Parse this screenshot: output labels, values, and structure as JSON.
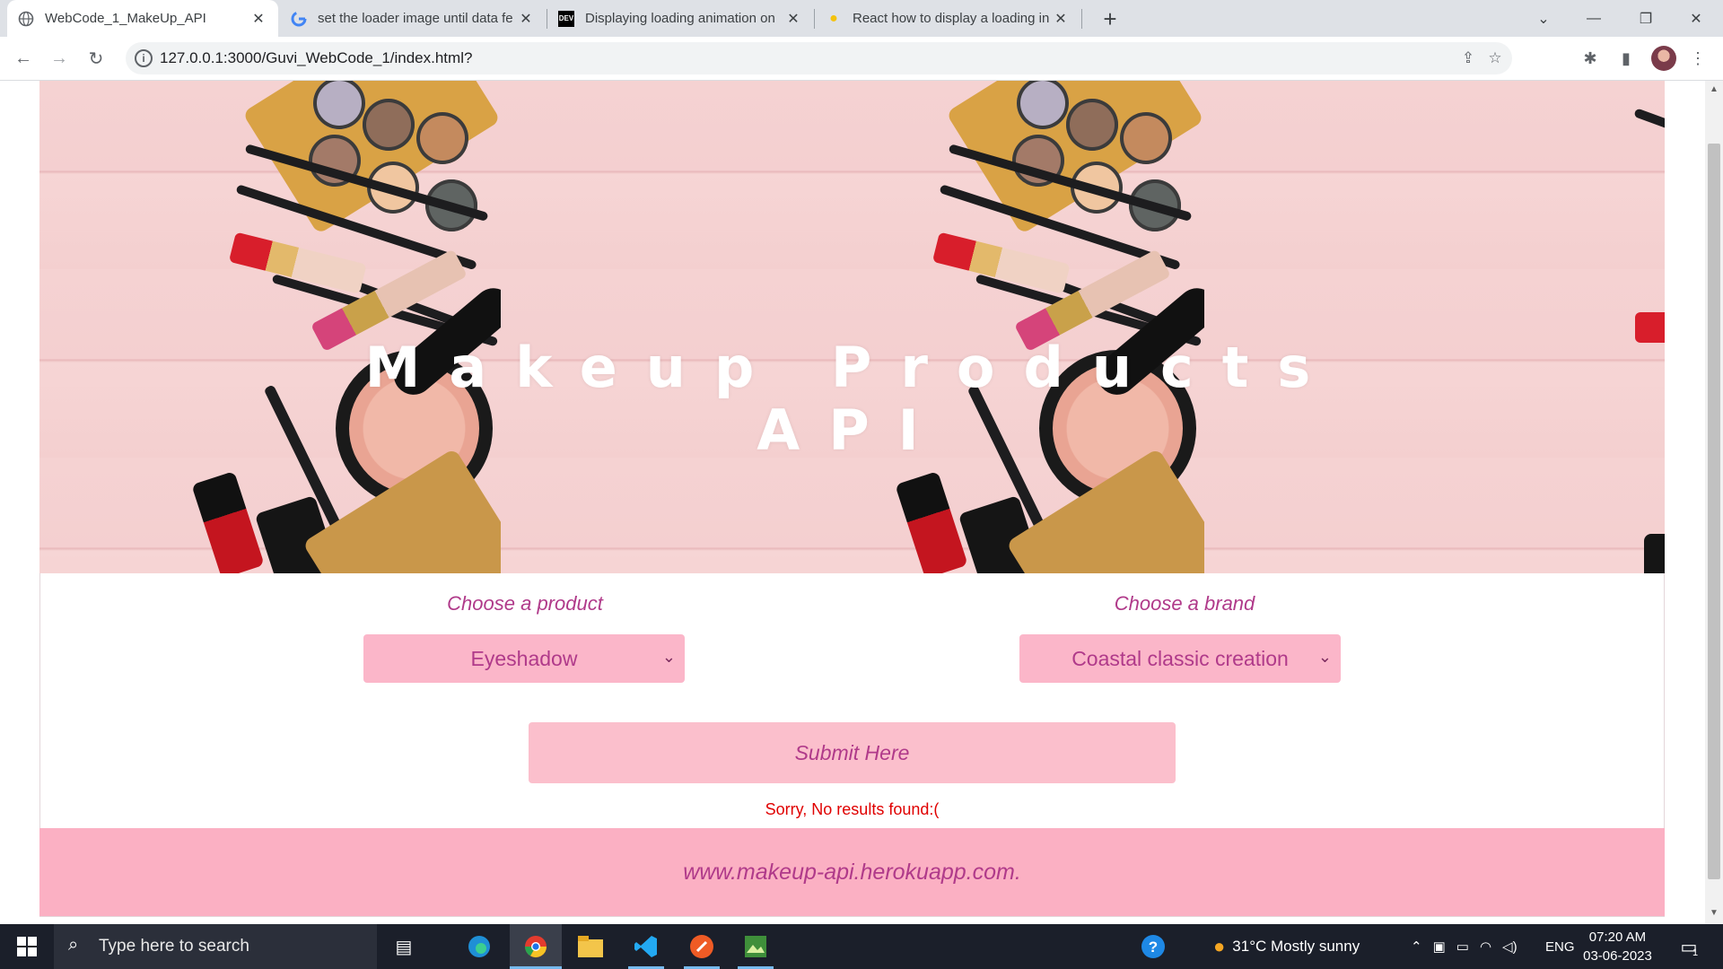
{
  "browser": {
    "tabs": [
      {
        "title": "WebCode_1_MakeUp_API",
        "favicon": "globe-icon",
        "active": true
      },
      {
        "title": "set the loader image until data fe",
        "favicon": "google-icon",
        "active": false
      },
      {
        "title": "Displaying loading animation on",
        "favicon": "dev-icon",
        "active": false
      },
      {
        "title": "React how to display a loading in",
        "favicon": "bulb-icon",
        "active": false
      }
    ],
    "dev_favicon_text": "DEV",
    "url": "127.0.0.1:3000/Guvi_WebCode_1/index.html?"
  },
  "page": {
    "hero_title_line1": "Makeup Products",
    "hero_title_line2": "API",
    "product_label": "Choose a product",
    "product_selected": "Eyeshadow",
    "brand_label": "Choose a brand",
    "brand_selected": "Coastal classic creation",
    "submit_label": "Submit Here",
    "no_results": "Sorry, No results found:(",
    "footer_text": "www.makeup-api.herokuapp.com."
  },
  "taskbar": {
    "search_placeholder": "Type here to search",
    "weather": "31°C  Mostly sunny",
    "language": "ENG",
    "time": "07:20 AM",
    "date": "03-06-2023",
    "notification_count": "1"
  },
  "colors": {
    "accent_text": "#b03a8a",
    "select_bg": "#fbb6c9",
    "footer_bg": "#fbb0c3",
    "error_text": "#e00000"
  }
}
